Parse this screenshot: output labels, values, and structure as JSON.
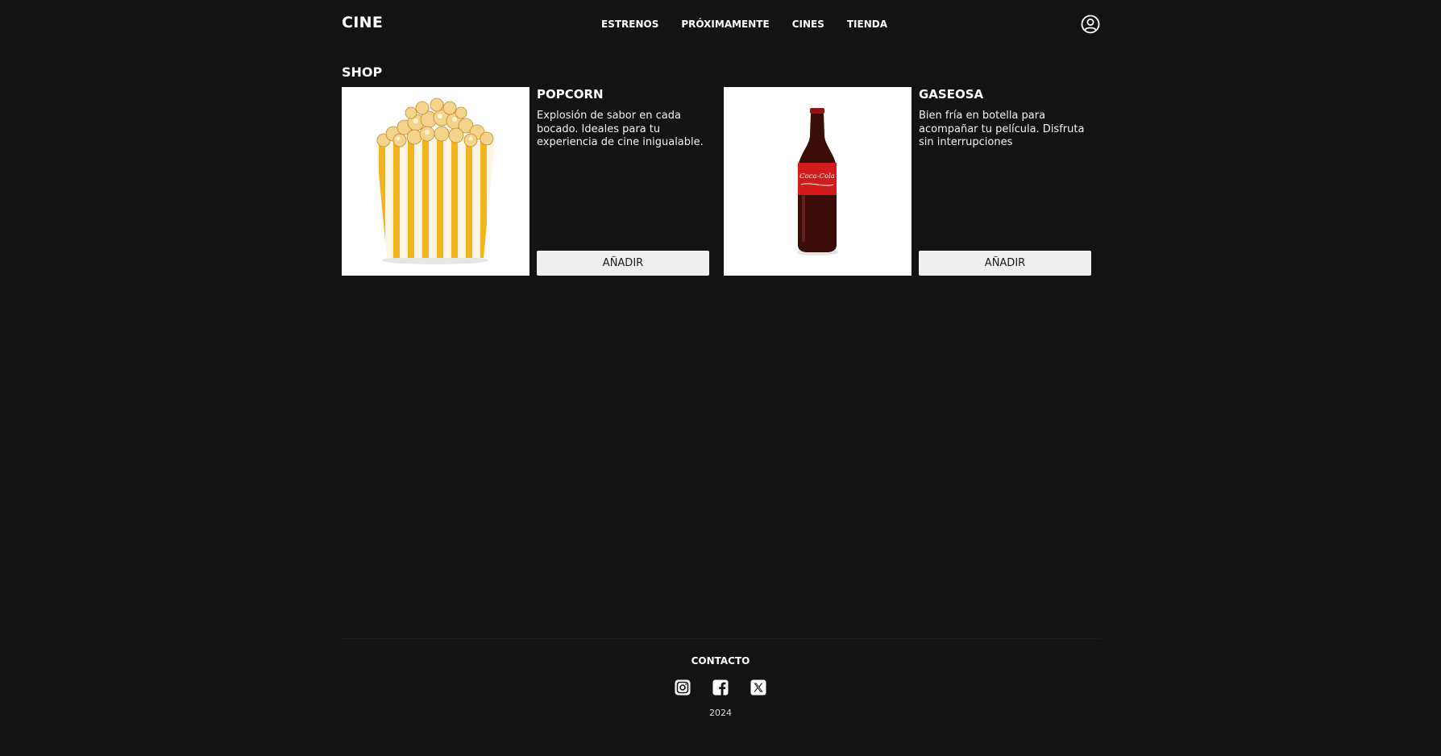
{
  "header": {
    "logo": "CINE",
    "nav": [
      "ESTRENOS",
      "PRÓXIMAMENTE",
      "CINES",
      "TIENDA"
    ],
    "user_icon": "user-circle-icon"
  },
  "shop": {
    "title": "SHOP",
    "products": [
      {
        "name": "POPCORN",
        "description": "Explosión de sabor en cada bocado. Ideales para tu experiencia de cine inigualable.",
        "button": "AÑADIR",
        "image": "popcorn-bucket"
      },
      {
        "name": "GASEOSA",
        "description": "Bien fría en botella para acompañar tu película. Disfruta sin interrupciones",
        "button": "AÑADIR",
        "image": "coca-cola-bottle",
        "image_label": "Coca-Cola"
      }
    ]
  },
  "footer": {
    "contact": "CONTACTO",
    "socials": [
      "instagram-icon",
      "facebook-icon",
      "x-icon"
    ],
    "year": "2024"
  },
  "colors": {
    "background": "#131313",
    "text": "#ffffff",
    "button_bg": "#efefef",
    "button_text": "#1b1b1b",
    "popcorn_stripe": "#f2b51e",
    "bottle_label": "#d21b1b"
  }
}
